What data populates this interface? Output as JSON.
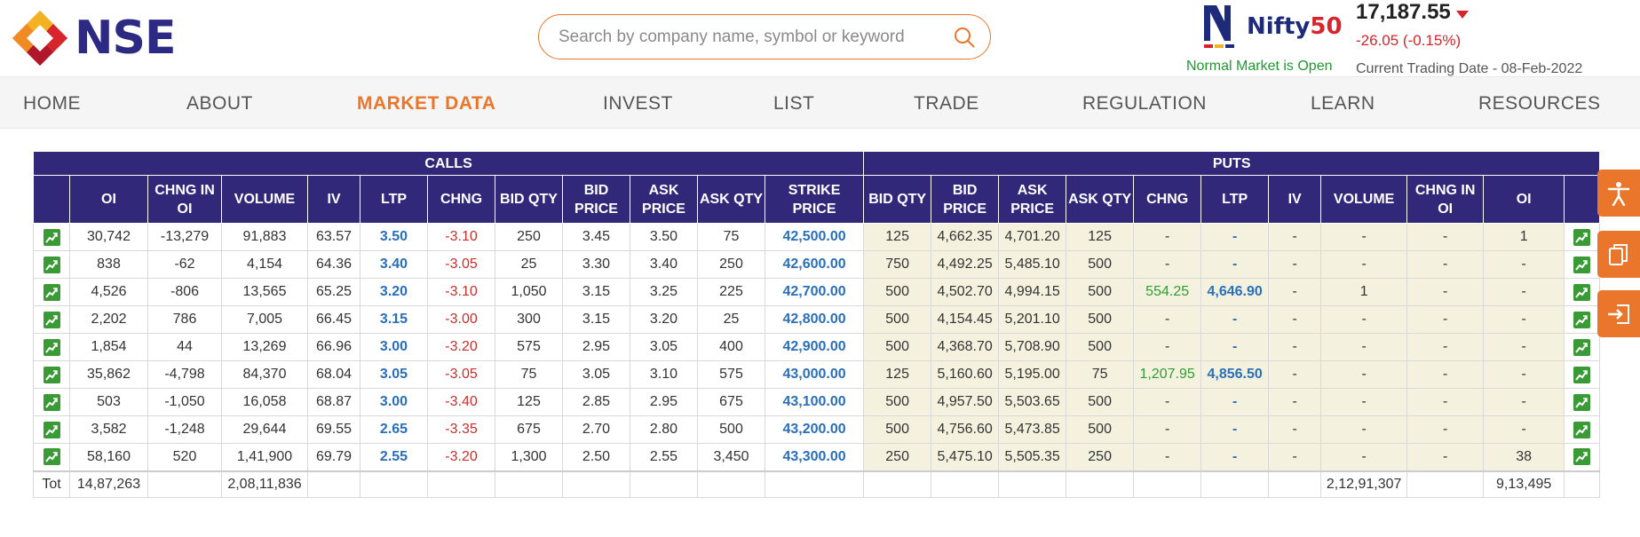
{
  "header": {
    "logo_text": "NSE",
    "search_placeholder": "Search by company name, symbol or keyword",
    "nifty_label_a": "Nifty",
    "nifty_label_b": "50",
    "market_status": "Normal Market is Open",
    "index_value": "17,187.55",
    "index_change": "-26.05 (-0.15%)",
    "trading_date": "Current Trading Date - 08-Feb-2022"
  },
  "nav": [
    "HOME",
    "ABOUT",
    "MARKET DATA",
    "INVEST",
    "LIST",
    "TRADE",
    "REGULATION",
    "LEARN",
    "RESOURCES"
  ],
  "nav_active": "MARKET DATA",
  "table": {
    "group_calls": "CALLS",
    "group_puts": "PUTS",
    "columns": [
      "OI",
      "CHNG IN OI",
      "VOLUME",
      "IV",
      "LTP",
      "CHNG",
      "BID QTY",
      "BID PRICE",
      "ASK PRICE",
      "ASK QTY",
      "STRIKE PRICE",
      "BID QTY",
      "BID PRICE",
      "ASK PRICE",
      "ASK QTY",
      "CHNG",
      "LTP",
      "IV",
      "VOLUME",
      "CHNG IN OI",
      "OI"
    ],
    "rows": [
      [
        "30,742",
        "-13,279",
        "91,883",
        "63.57",
        "3.50",
        "-3.10",
        "250",
        "3.45",
        "3.50",
        "75",
        "42,500.00",
        "125",
        "4,662.35",
        "4,701.20",
        "125",
        "-",
        "-",
        "-",
        "-",
        "-",
        "1"
      ],
      [
        "838",
        "-62",
        "4,154",
        "64.36",
        "3.40",
        "-3.05",
        "25",
        "3.30",
        "3.40",
        "250",
        "42,600.00",
        "750",
        "4,492.25",
        "5,485.10",
        "500",
        "-",
        "-",
        "-",
        "-",
        "-",
        "-"
      ],
      [
        "4,526",
        "-806",
        "13,565",
        "65.25",
        "3.20",
        "-3.10",
        "1,050",
        "3.15",
        "3.25",
        "225",
        "42,700.00",
        "500",
        "4,502.70",
        "4,994.15",
        "500",
        "554.25",
        "4,646.90",
        "-",
        "1",
        "-",
        "-"
      ],
      [
        "2,202",
        "786",
        "7,005",
        "66.45",
        "3.15",
        "-3.00",
        "300",
        "3.15",
        "3.20",
        "25",
        "42,800.00",
        "500",
        "4,154.45",
        "5,201.10",
        "500",
        "-",
        "-",
        "-",
        "-",
        "-",
        "-"
      ],
      [
        "1,854",
        "44",
        "13,269",
        "66.96",
        "3.00",
        "-3.20",
        "575",
        "2.95",
        "3.05",
        "400",
        "42,900.00",
        "500",
        "4,368.70",
        "5,708.90",
        "500",
        "-",
        "-",
        "-",
        "-",
        "-",
        "-"
      ],
      [
        "35,862",
        "-4,798",
        "84,370",
        "68.04",
        "3.05",
        "-3.05",
        "75",
        "3.05",
        "3.10",
        "575",
        "43,000.00",
        "125",
        "5,160.60",
        "5,195.00",
        "75",
        "1,207.95",
        "4,856.50",
        "-",
        "-",
        "-",
        "-"
      ],
      [
        "503",
        "-1,050",
        "16,058",
        "68.87",
        "3.00",
        "-3.40",
        "125",
        "2.85",
        "2.95",
        "675",
        "43,100.00",
        "500",
        "4,957.50",
        "5,503.65",
        "500",
        "-",
        "-",
        "-",
        "-",
        "-",
        "-"
      ],
      [
        "3,582",
        "-1,248",
        "29,644",
        "69.55",
        "2.65",
        "-3.35",
        "675",
        "2.70",
        "2.80",
        "500",
        "43,200.00",
        "500",
        "4,756.60",
        "5,473.85",
        "500",
        "-",
        "-",
        "-",
        "-",
        "-",
        "-"
      ],
      [
        "58,160",
        "520",
        "1,41,900",
        "69.79",
        "2.55",
        "-3.20",
        "1,300",
        "2.50",
        "2.55",
        "3,450",
        "43,300.00",
        "250",
        "5,475.10",
        "5,505.35",
        "250",
        "-",
        "-",
        "-",
        "-",
        "-",
        "38"
      ]
    ],
    "total": {
      "label": "Tot",
      "calls_oi": "14,87,263",
      "calls_volume": "2,08,11,836",
      "puts_volume": "2,12,91,307",
      "puts_oi": "9,13,495"
    }
  },
  "colors": {
    "accent": "#e9762b",
    "table_header": "#32287a",
    "put_bg": "#f4f2df",
    "link_blue": "#2a6fba",
    "negative": "#c9302c",
    "positive": "#2f9e33"
  },
  "icons": [
    "search-icon",
    "down-arrow-icon",
    "chart-icon",
    "accessibility-icon",
    "copy-icon",
    "login-icon"
  ]
}
